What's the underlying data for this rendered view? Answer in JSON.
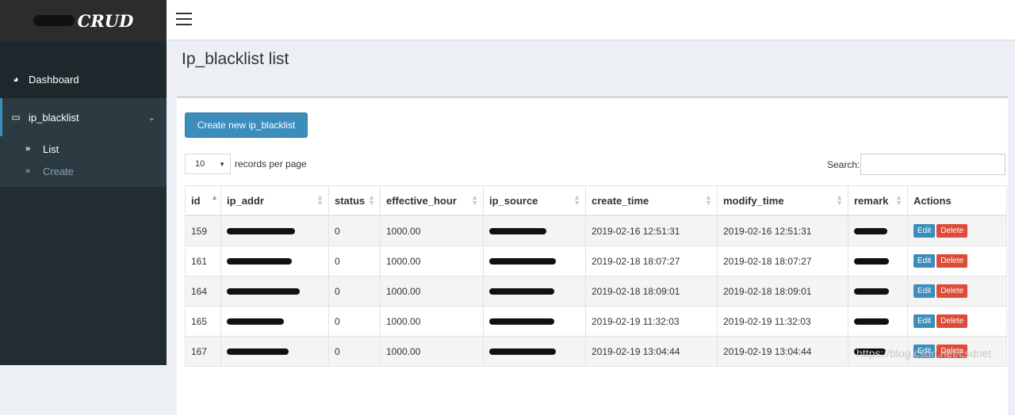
{
  "brand": {
    "text": "CRUD"
  },
  "sidebar": {
    "items": [
      {
        "label": "Dashboard",
        "icon": "dashboard-icon"
      },
      {
        "label": "ip_blacklist",
        "icon": "folder-icon",
        "expanded": true,
        "children": [
          {
            "label": "List",
            "active": true
          },
          {
            "label": "Create",
            "active": false
          }
        ]
      }
    ]
  },
  "page": {
    "title": "Ip_blacklist list"
  },
  "toolbar": {
    "create_label": "Create new ip_blacklist",
    "page_length": "10",
    "records_label": "records per page",
    "search_label": "Search:",
    "search_value": ""
  },
  "table": {
    "columns": [
      "id",
      "ip_addr",
      "status",
      "effective_hour",
      "ip_source",
      "create_time",
      "modify_time",
      "remark",
      "Actions"
    ],
    "rows": [
      {
        "id": "159",
        "status": "0",
        "effective_hour": "1000.00",
        "create_time": "2019-02-16 12:51:31",
        "modify_time": "2019-02-16 12:51:31"
      },
      {
        "id": "161",
        "status": "0",
        "effective_hour": "1000.00",
        "create_time": "2019-02-18 18:07:27",
        "modify_time": "2019-02-18 18:07:27"
      },
      {
        "id": "164",
        "status": "0",
        "effective_hour": "1000.00",
        "create_time": "2019-02-18 18:09:01",
        "modify_time": "2019-02-18 18:09:01"
      },
      {
        "id": "165",
        "status": "0",
        "effective_hour": "1000.00",
        "create_time": "2019-02-19 11:32:03",
        "modify_time": "2019-02-19 11:32:03"
      },
      {
        "id": "167",
        "status": "0",
        "effective_hour": "1000.00",
        "create_time": "2019-02-19 13:04:44",
        "modify_time": "2019-02-19 13:04:44"
      }
    ],
    "edit_label": "Edit",
    "delete_label": "Delete"
  },
  "watermark": "https://blog.csdn.net/csdnet",
  "colors": {
    "sidebar": "#222d32",
    "primary": "#3c8dbc",
    "danger": "#dd4b39",
    "background": "#ecf0f5"
  }
}
